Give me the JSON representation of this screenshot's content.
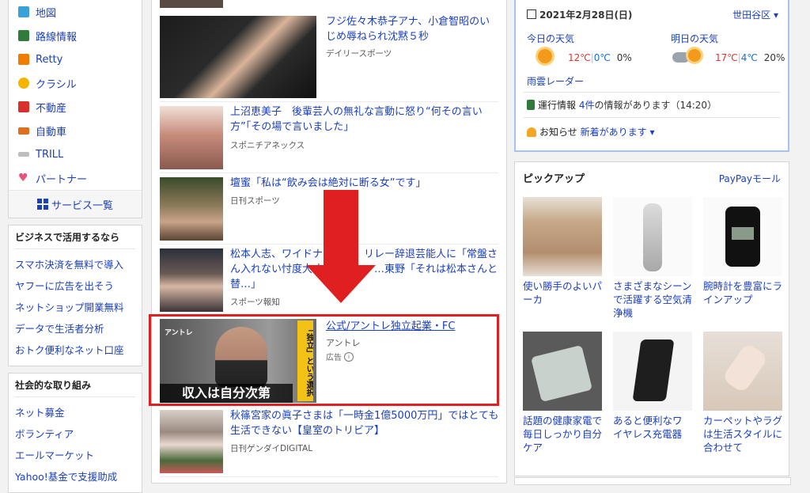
{
  "services": [
    {
      "label": "地図",
      "icon": "map-icon",
      "color": "#3aa0d8"
    },
    {
      "label": "路線情報",
      "icon": "train-icon",
      "color": "#2f7a3c"
    },
    {
      "label": "Retty",
      "icon": "retty-icon",
      "color": "#f07c00"
    },
    {
      "label": "クラシル",
      "icon": "kurashiru-icon",
      "color": "#f4b400"
    },
    {
      "label": "不動産",
      "icon": "house-icon",
      "color": "#d9302c"
    },
    {
      "label": "自動車",
      "icon": "car-icon",
      "color": "#e07020"
    },
    {
      "label": "TRILL",
      "icon": "trill-icon",
      "color": "#9a9a9a"
    },
    {
      "label": "パートナー",
      "icon": "heart-icon",
      "color": "#e8517b"
    }
  ],
  "services_all": "サービス一覧",
  "business": {
    "title": "ビジネスで活用するなら",
    "links": [
      "スマホ決済を無料で導入",
      "ヤフーに広告を出そう",
      "ネットショップ開業無料",
      "データで生活者分析",
      "おトク便利なネット口座"
    ]
  },
  "social": {
    "title": "社会的な取り組み",
    "links": [
      "ネット募金",
      "ボランティア",
      "エールマーケット",
      "Yahoo!基金で支援助成"
    ]
  },
  "news": [
    {
      "title": "フジ佐々木恭子アナ、小倉智昭のいじめ辱ねられ沈黙５秒",
      "source": "デイリースポーツ"
    },
    {
      "title": "上沼恵美子　後輩芸人の無礼な言動に怒り“何その言い方”「その場で言いました」",
      "source": "スポニチアネックス"
    },
    {
      "title": "壇蜜「私は“飲み会は絶対に断る女”です」",
      "source": "日刊スポーツ"
    },
    {
      "title": "松本人志、ワイドナショー　リレー辞退芸能人に「常盤さん入れない忖度大丈夫？悪い」…東野「それは松本さんと替…」",
      "source": "スポーツ報知"
    },
    {
      "title": "秋篠宮家の眞子さまは「一時金1億5000万円」ではとても生活できない【皇室のトリビア】",
      "source": "日刊ゲンダイDIGITAL"
    }
  ],
  "ad": {
    "title": "公式/アントレ独立起業・FC",
    "advertiser": "アントレ",
    "label": "広告",
    "banner_logo": "アントレ",
    "banner_caption": "収入は自分次第",
    "banner_side": "「独立」という選択"
  },
  "weather": {
    "date": "2021年2月28日(日)",
    "area": "世田谷区",
    "today_label": "今日の天気",
    "today_high": "12℃",
    "today_low": "0℃",
    "today_rain": "0%",
    "tomorrow_label": "明日の天気",
    "tomorrow_high": "17℃",
    "tomorrow_low": "4℃",
    "tomorrow_rain": "20%",
    "radar": "雨雲レーダー",
    "train_label": "運行情報",
    "train_count": "4件",
    "train_text": "の情報があります（14:20）",
    "notice_label": "お知らせ",
    "notice_text": "新着があります"
  },
  "pickup": {
    "title": "ピックアップ",
    "store": "PayPayモール",
    "items": [
      "使い勝手のよいパーカ",
      "さまざまなシーンで活躍する空気清浄機",
      "腕時計を豊富にラインアップ",
      "話題の健康家電で毎日しっかり自分ケア",
      "あると便利なワイヤレス充電器",
      "カーペットやラグは生活スタイルに合わせて"
    ]
  },
  "colors": {
    "link": "#1a3fbf",
    "highlight_red": "#e02020",
    "temp_high": "#e5322d",
    "temp_low": "#1d6fd1"
  }
}
